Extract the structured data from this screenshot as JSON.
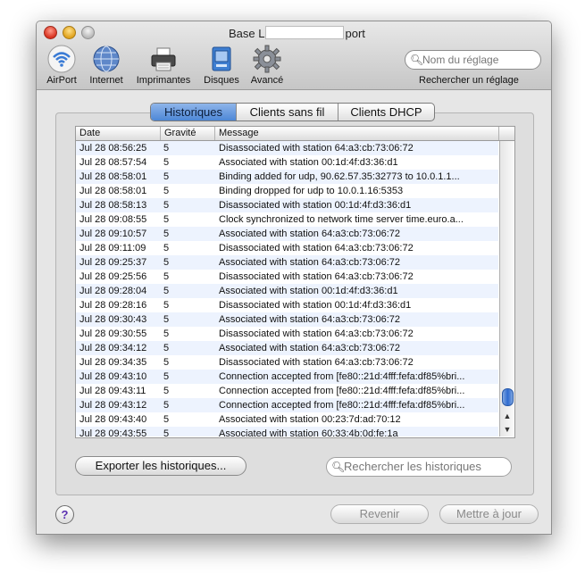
{
  "window": {
    "title_left": "Base L",
    "title_right": "port"
  },
  "toolbar": {
    "items": [
      {
        "label": "AirPort",
        "icon": "airport-icon"
      },
      {
        "label": "Internet",
        "icon": "globe-icon"
      },
      {
        "label": "Imprimantes",
        "icon": "printer-icon"
      },
      {
        "label": "Disques",
        "icon": "disk-icon"
      },
      {
        "label": "Avancé",
        "icon": "gear-icon"
      }
    ],
    "search": {
      "placeholder": "Nom du réglage",
      "caption": "Rechercher un réglage"
    }
  },
  "tabs": [
    {
      "label": "Historiques",
      "active": true
    },
    {
      "label": "Clients sans fil",
      "active": false
    },
    {
      "label": "Clients DHCP",
      "active": false
    }
  ],
  "table": {
    "columns": [
      "Date",
      "Gravité",
      "Message"
    ],
    "rows": [
      {
        "date": "Jul 28 08:56:25",
        "gravite": "5",
        "message": "Disassociated with station 64:a3:cb:73:06:72"
      },
      {
        "date": "Jul 28 08:57:54",
        "gravite": "5",
        "message": "Associated with station 00:1d:4f:d3:36:d1"
      },
      {
        "date": "Jul 28 08:58:01",
        "gravite": "5",
        "message": "Binding added for udp, 90.62.57.35:32773 to 10.0.1.1..."
      },
      {
        "date": "Jul 28 08:58:01",
        "gravite": "5",
        "message": "Binding dropped for udp to 10.0.1.16:5353"
      },
      {
        "date": "Jul 28 08:58:13",
        "gravite": "5",
        "message": "Disassociated with station 00:1d:4f:d3:36:d1"
      },
      {
        "date": "Jul 28 09:08:55",
        "gravite": "5",
        "message": "Clock synchronized to network time server time.euro.a..."
      },
      {
        "date": "Jul 28 09:10:57",
        "gravite": "5",
        "message": "Associated with station 64:a3:cb:73:06:72"
      },
      {
        "date": "Jul 28 09:11:09",
        "gravite": "5",
        "message": "Disassociated with station 64:a3:cb:73:06:72"
      },
      {
        "date": "Jul 28 09:25:37",
        "gravite": "5",
        "message": "Associated with station 64:a3:cb:73:06:72"
      },
      {
        "date": "Jul 28 09:25:56",
        "gravite": "5",
        "message": "Disassociated with station 64:a3:cb:73:06:72"
      },
      {
        "date": "Jul 28 09:28:04",
        "gravite": "5",
        "message": "Associated with station 00:1d:4f:d3:36:d1"
      },
      {
        "date": "Jul 28 09:28:16",
        "gravite": "5",
        "message": "Disassociated with station 00:1d:4f:d3:36:d1"
      },
      {
        "date": "Jul 28 09:30:43",
        "gravite": "5",
        "message": "Associated with station 64:a3:cb:73:06:72"
      },
      {
        "date": "Jul 28 09:30:55",
        "gravite": "5",
        "message": "Disassociated with station 64:a3:cb:73:06:72"
      },
      {
        "date": "Jul 28 09:34:12",
        "gravite": "5",
        "message": "Associated with station 64:a3:cb:73:06:72"
      },
      {
        "date": "Jul 28 09:34:35",
        "gravite": "5",
        "message": "Disassociated with station 64:a3:cb:73:06:72"
      },
      {
        "date": "Jul 28 09:43:10",
        "gravite": "5",
        "message": "Connection accepted from [fe80::21d:4fff:fefa:df85%bri..."
      },
      {
        "date": "Jul 28 09:43:11",
        "gravite": "5",
        "message": "Connection accepted from [fe80::21d:4fff:fefa:df85%bri..."
      },
      {
        "date": "Jul 28 09:43:12",
        "gravite": "5",
        "message": "Connection accepted from [fe80::21d:4fff:fefa:df85%bri..."
      },
      {
        "date": "Jul 28 09:43:40",
        "gravite": "5",
        "message": "Associated with station 00:23:7d:ad:70:12"
      },
      {
        "date": "Jul 28 09:43:55",
        "gravite": "5",
        "message": "Associated with station 60:33:4b:0d:fe:1a"
      }
    ]
  },
  "export_button": "Exporter les historiques...",
  "log_search_placeholder": "Rechercher les historiques",
  "footer": {
    "help": "?",
    "revert": "Revenir",
    "update": "Mettre à jour"
  },
  "colors": {
    "active_tab": "#4d87d6",
    "row_stripe": "#edf3fe",
    "help_accent": "#5a2fb0"
  }
}
